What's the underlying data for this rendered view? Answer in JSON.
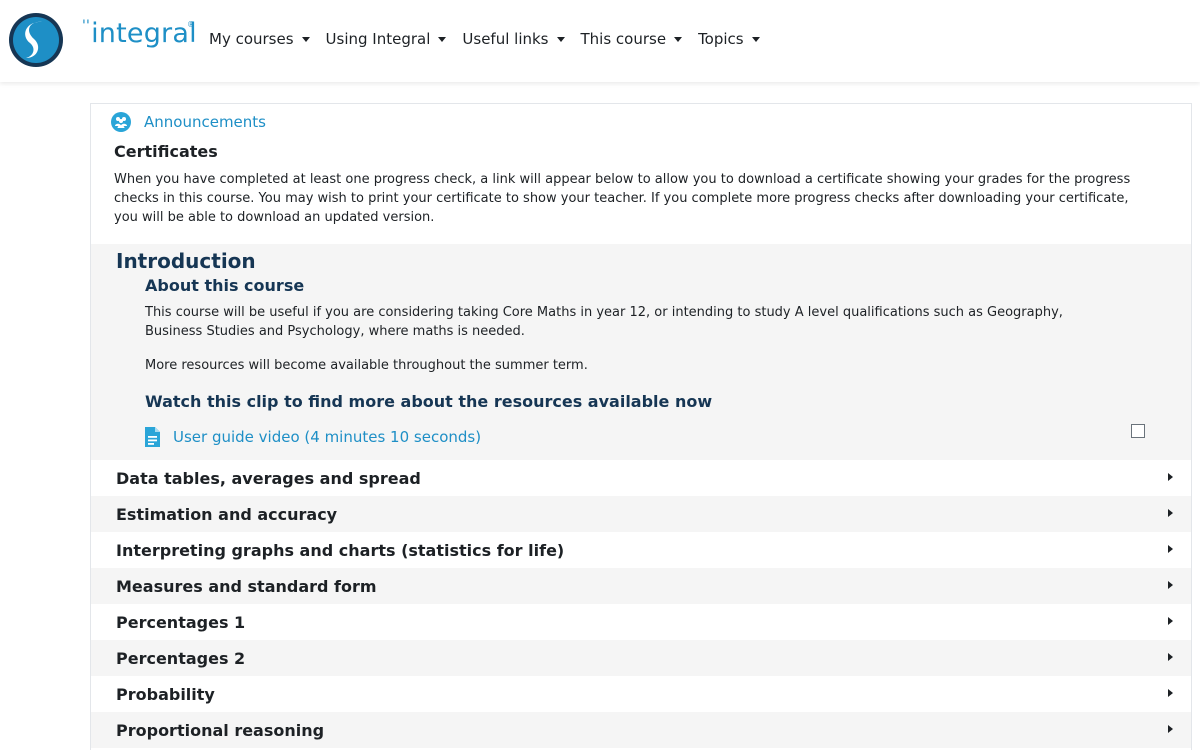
{
  "navbar": {
    "logo": {
      "brand_text": "integral",
      "tick": "''",
      "reg_mark": "®",
      "colors": {
        "accent": "#1e8fc6",
        "dark": "#163654"
      }
    },
    "menu": [
      {
        "label": "My courses"
      },
      {
        "label": "Using Integral"
      },
      {
        "label": "Useful links"
      },
      {
        "label": "This course"
      },
      {
        "label": "Topics"
      }
    ]
  },
  "announcements": {
    "icon": "people-icon",
    "label": "Announcements"
  },
  "certificates": {
    "title": "Certificates",
    "text": "When you have completed at least one progress check, a link will appear below to allow you to download a certificate showing your grades for the progress checks in this course. You may wish to print your certificate to show your teacher. If you complete more progress checks after downloading your certificate, you will be able to download an updated version."
  },
  "introduction": {
    "title": "Introduction",
    "about_title": "About this course",
    "about_text": "This course will be useful if you are considering taking Core Maths in year 12, or intending to study A level qualifications such as Geography, Business Studies and Psychology, where maths is needed.",
    "more_text": "More resources will become available throughout the summer term.",
    "watch_title": "Watch this clip to find more about the resources available now",
    "resource": {
      "icon": "file-icon",
      "label": "User guide video (4 minutes 10 seconds)",
      "completed": false
    }
  },
  "topics": [
    {
      "label": "Data tables, averages and spread"
    },
    {
      "label": "Estimation and accuracy"
    },
    {
      "label": "Interpreting graphs and charts (statistics for life)"
    },
    {
      "label": "Measures and standard form"
    },
    {
      "label": "Percentages 1"
    },
    {
      "label": "Percentages 2"
    },
    {
      "label": "Probability"
    },
    {
      "label": "Proportional reasoning"
    }
  ],
  "colors": {
    "link": "#1e8fc6",
    "heading": "#163654",
    "section_bg": "#f5f5f5"
  }
}
